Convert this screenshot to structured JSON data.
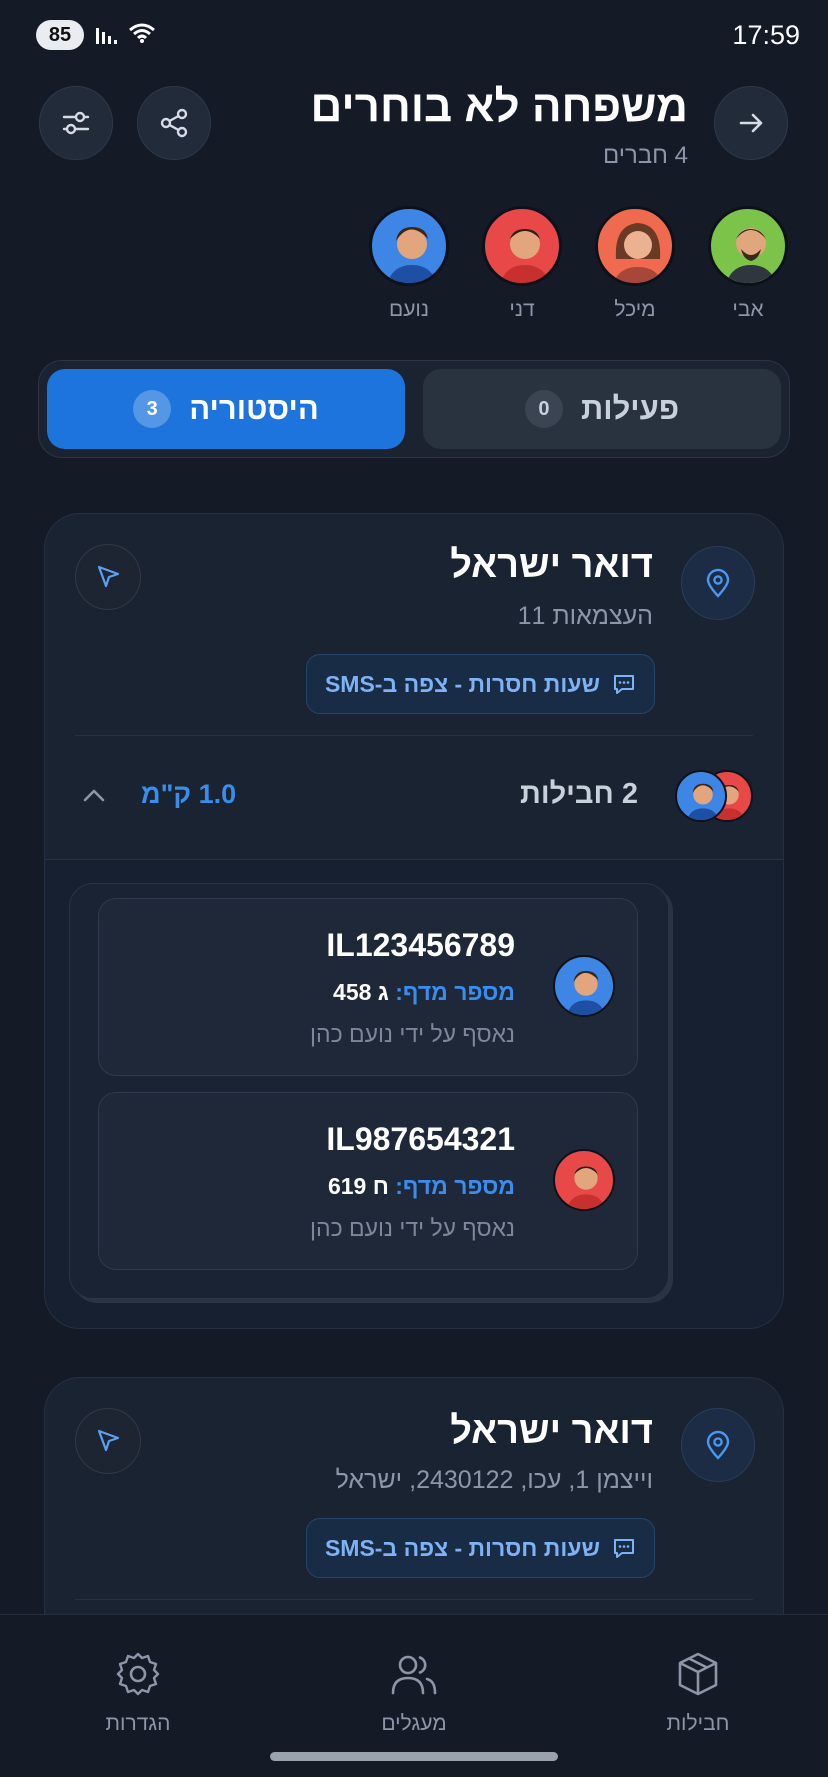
{
  "status_bar": {
    "time": "17:59",
    "battery": "85"
  },
  "header": {
    "title": "משפחה לא בוחרים",
    "subtitle": "4 חברים"
  },
  "members": [
    {
      "name": "אבי",
      "color": "#7cc34a"
    },
    {
      "name": "מיכל",
      "color": "#f06a4f"
    },
    {
      "name": "דני",
      "color": "#e84848"
    },
    {
      "name": "נועם",
      "color": "#3d86e6"
    }
  ],
  "tabs": [
    {
      "label": "פעילות",
      "count": "0"
    },
    {
      "label": "היסטוריה",
      "count": "3"
    }
  ],
  "cards": [
    {
      "title": "דואר ישראל",
      "address": "העצמאות 11",
      "sms": "שעות חסרות - צפה ב-SMS",
      "packages_label": "2 חבילות",
      "distance": "1.0 ק\"מ",
      "packages": [
        {
          "tracking": "IL123456789",
          "shelf_label": "מספר מדף:",
          "shelf": "ג 458",
          "collected_by": "נאסף על ידי נועם כהן"
        },
        {
          "tracking": "IL987654321",
          "shelf_label": "מספר מדף:",
          "shelf": "ח 619",
          "collected_by": "נאסף על ידי נועם כהן"
        }
      ]
    },
    {
      "title": "דואר ישראל",
      "address": "וייצמן 1, עכו, 2430122, ישראל",
      "sms": "שעות חסרות - צפה ב-SMS"
    }
  ],
  "bottom_nav": [
    {
      "label": "חבילות",
      "icon": "package-icon"
    },
    {
      "label": "מעגלים",
      "icon": "users-icon"
    },
    {
      "label": "הגדרות",
      "icon": "gear-icon"
    }
  ],
  "colors": {
    "accent": "#1d74dc",
    "background": "#141b27"
  }
}
